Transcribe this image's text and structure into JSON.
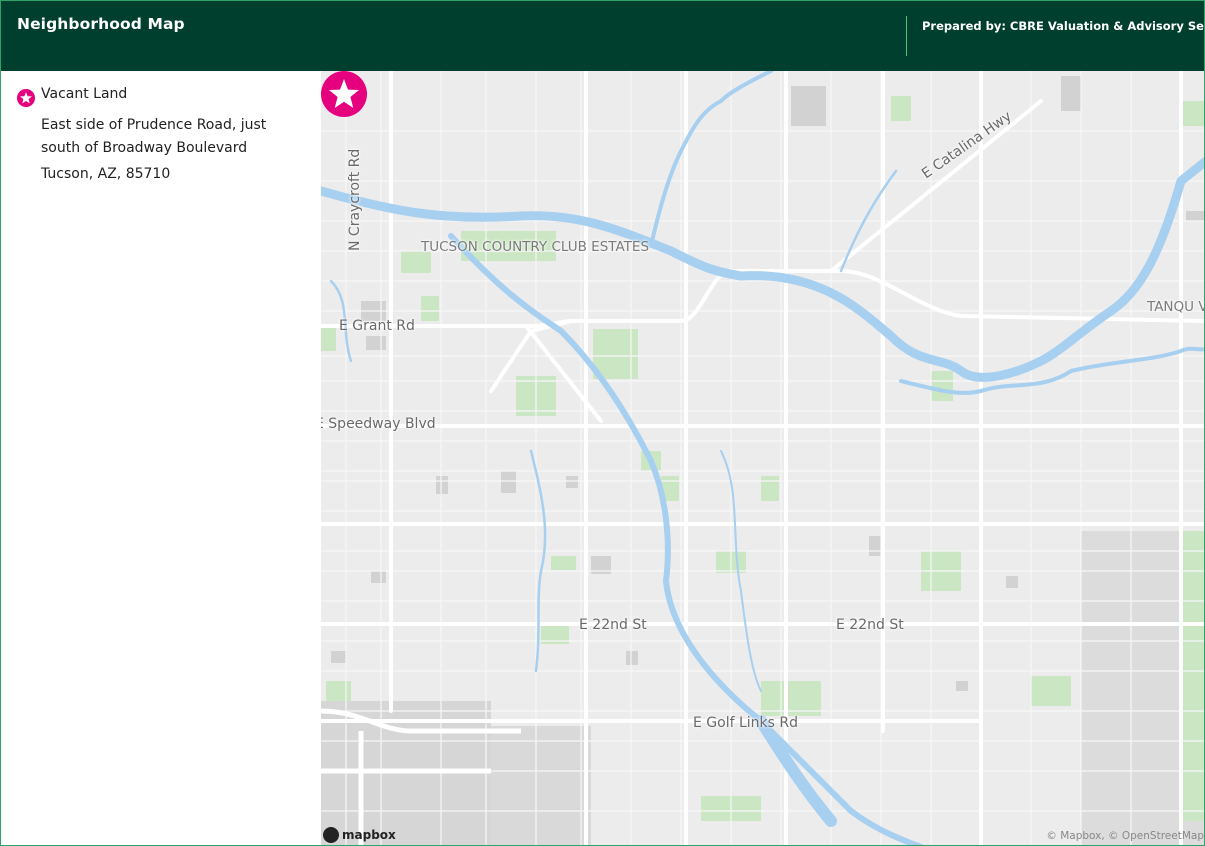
{
  "header": {
    "title": "Neighborhood Map",
    "prepared_by": "Prepared by: CBRE Valuation & Advisory Servic"
  },
  "legend": {
    "icon": "star-icon",
    "label": "Vacant Land",
    "address": "East side of Prudence Road, just south of Broadway Boulevard",
    "city": "Tucson, AZ, 85710"
  },
  "map": {
    "labels": {
      "craycroft": "N Craycroft Rd",
      "catalina": "E Catalina Hwy",
      "tucson_country_club": "TUCSON COUNTRY CLUB ESTATES",
      "tanque_verde": "TANQU VERDE",
      "grant": "E Grant Rd",
      "speedway": "E Speedway Blvd",
      "st22": "E 22nd St",
      "st22_east": "E 22nd St",
      "golf_links": "E Golf Links Rd"
    },
    "logo": "mapbox",
    "attribution": "© Mapbox, © OpenStreetMap"
  },
  "colors": {
    "header_bg": "#003f2d",
    "accent": "#2fa36b",
    "marker": "#e5007e",
    "water": "#a7cff0",
    "park": "#cbe6c3",
    "roads": "#ffffff",
    "land": "#ececec"
  }
}
